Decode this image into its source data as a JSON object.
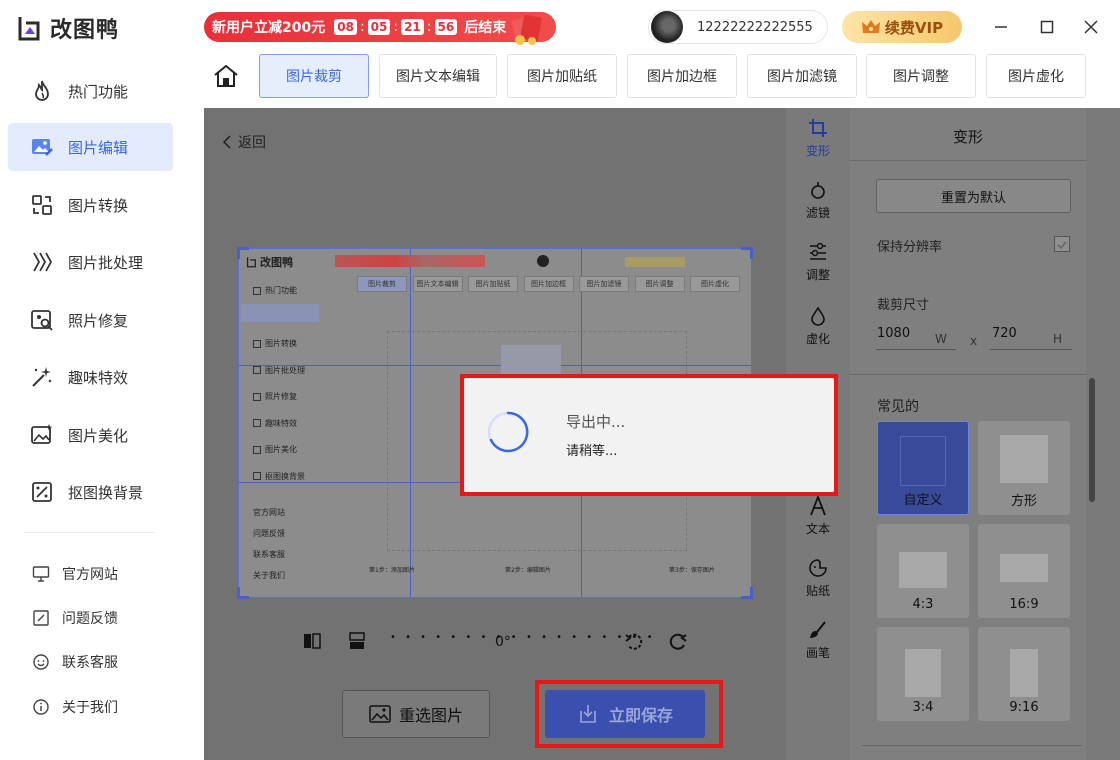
{
  "app": {
    "name": "改图鸭"
  },
  "promo": {
    "text": "新用户立减200元",
    "countdown": [
      "08",
      "05",
      "21",
      "56"
    ],
    "suffix": "后结束"
  },
  "user": {
    "id": "12222222222555"
  },
  "vip": {
    "label": "续费VIP"
  },
  "sidebar": {
    "items": [
      {
        "label": "热门功能",
        "icon": "fire-icon"
      },
      {
        "label": "图片编辑",
        "icon": "image-edit-icon",
        "active": true
      },
      {
        "label": "图片转换",
        "icon": "convert-icon"
      },
      {
        "label": "图片批处理",
        "icon": "batch-icon"
      },
      {
        "label": "照片修复",
        "icon": "repair-icon"
      },
      {
        "label": "趣味特效",
        "icon": "magic-wand-icon"
      },
      {
        "label": "图片美化",
        "icon": "beautify-icon"
      },
      {
        "label": "抠图换背景",
        "icon": "cutout-icon"
      }
    ],
    "footer": [
      {
        "label": "官方网站",
        "icon": "monitor-icon"
      },
      {
        "label": "问题反馈",
        "icon": "feedback-icon"
      },
      {
        "label": "联系客服",
        "icon": "service-icon"
      },
      {
        "label": "关于我们",
        "icon": "info-icon"
      }
    ]
  },
  "tabs": [
    {
      "label": "图片裁剪",
      "active": true
    },
    {
      "label": "图片文本编辑"
    },
    {
      "label": "图片加贴纸"
    },
    {
      "label": "图片加边框"
    },
    {
      "label": "图片加滤镜"
    },
    {
      "label": "图片调整"
    },
    {
      "label": "图片虚化"
    }
  ],
  "editor": {
    "back_label": "返回",
    "rotation": "0°",
    "reselect_label": "重选图片",
    "save_label": "立即保存"
  },
  "preview": {
    "app_name": "改图鸭",
    "nav": [
      "热门功能",
      "图片编辑",
      "图片转换",
      "图片批处理",
      "照片修复",
      "趣味特效",
      "图片美化",
      "抠图换背景"
    ],
    "footer": [
      "官方网站",
      "问题反馈",
      "联系客服",
      "关于我们"
    ],
    "tabs": [
      "图片裁剪",
      "图片文本编辑",
      "图片加贴纸",
      "图片加边框",
      "图片加滤镜",
      "图片调整",
      "图片虚化"
    ],
    "steps": [
      {
        "title": "第1步：添加图片"
      },
      {
        "title": "第2步：编辑图片"
      },
      {
        "title": "第3步：保存图片"
      }
    ]
  },
  "tools": [
    {
      "label": "变形",
      "icon": "crop-icon"
    },
    {
      "label": "滤镜",
      "icon": "filter-icon"
    },
    {
      "label": "调整",
      "icon": "adjust-icon"
    },
    {
      "label": "虚化",
      "icon": "blur-icon"
    },
    {
      "label": "文本",
      "icon": "text-icon"
    },
    {
      "label": "贴纸",
      "icon": "sticker-icon"
    },
    {
      "label": "画笔",
      "icon": "brush-icon"
    }
  ],
  "panel": {
    "title": "变形",
    "reset_label": "重置为默认",
    "keep_resolution_label": "保持分辨率",
    "crop_size_label": "裁剪尺寸",
    "width": "1080",
    "width_unit": "W",
    "times": "x",
    "height": "720",
    "height_unit": "H",
    "common_label": "常见的",
    "presets": [
      "自定义",
      "方形",
      "4:3",
      "16:9",
      "3:4",
      "9:16"
    ]
  },
  "dialog": {
    "title": "导出中...",
    "subtitle": "请稍等..."
  },
  "colors": {
    "accent": "#3a66e5",
    "highlight": "#e61818",
    "promo": "#e8303a"
  }
}
